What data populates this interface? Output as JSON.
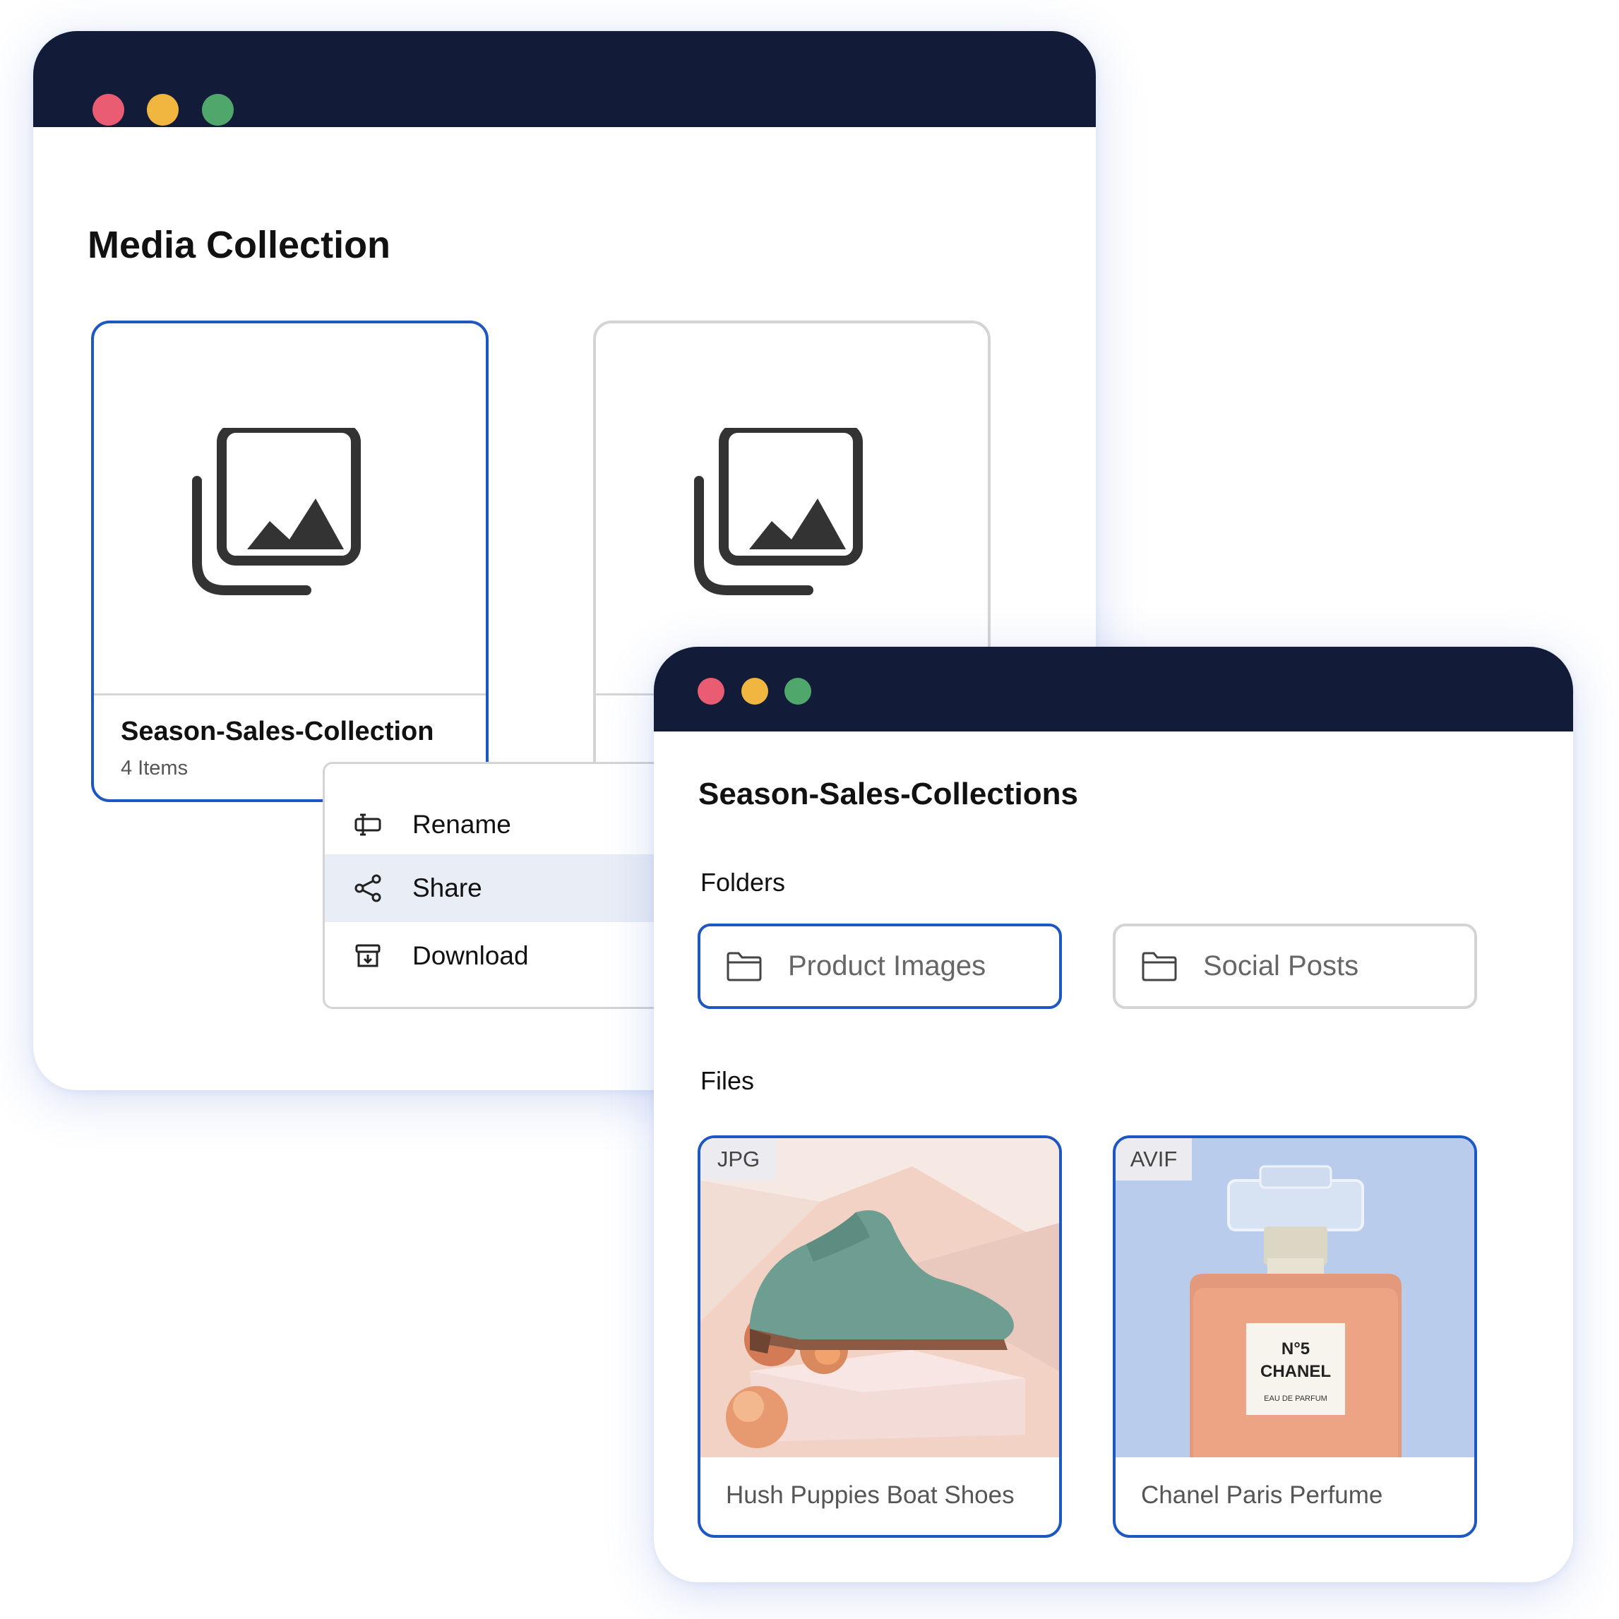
{
  "colors": {
    "titlebar": "#121c38",
    "accent": "#1d57c4",
    "window_dot_close": "#e95c72",
    "window_dot_minimize": "#f0b63f",
    "window_dot_maximize": "#4fa76b",
    "menu_highlight": "#e9edf6"
  },
  "media_window": {
    "title": "Media Collection",
    "collections": [
      {
        "name": "Season-Sales-Collection",
        "count": "4 Items",
        "icon": "gallery-icon",
        "selected": true
      },
      {
        "name": "",
        "count": "",
        "icon": "gallery-icon",
        "selected": false
      }
    ],
    "context_menu": [
      {
        "label": "Rename",
        "icon": "rename-icon",
        "highlighted": false
      },
      {
        "label": "Share",
        "icon": "share-icon",
        "highlighted": true
      },
      {
        "label": "Download",
        "icon": "download-icon",
        "highlighted": false
      }
    ]
  },
  "collection_window": {
    "title": "Season-Sales-Collections",
    "folders_label": "Folders",
    "folders": [
      {
        "label": "Product Images",
        "icon": "folder-icon",
        "selected": true
      },
      {
        "label": "Social Posts",
        "icon": "folder-icon",
        "selected": false
      }
    ],
    "files_label": "Files",
    "files": [
      {
        "type": "JPG",
        "name": "Hush Puppies Boat Shoes",
        "thumbnail": "shoe-photo"
      },
      {
        "type": "AVIF",
        "name": "Chanel Paris Perfume",
        "thumbnail": "perfume-photo",
        "label_text": [
          "N°5",
          "CHANEL",
          "EAU DE PARFUM"
        ]
      }
    ]
  }
}
